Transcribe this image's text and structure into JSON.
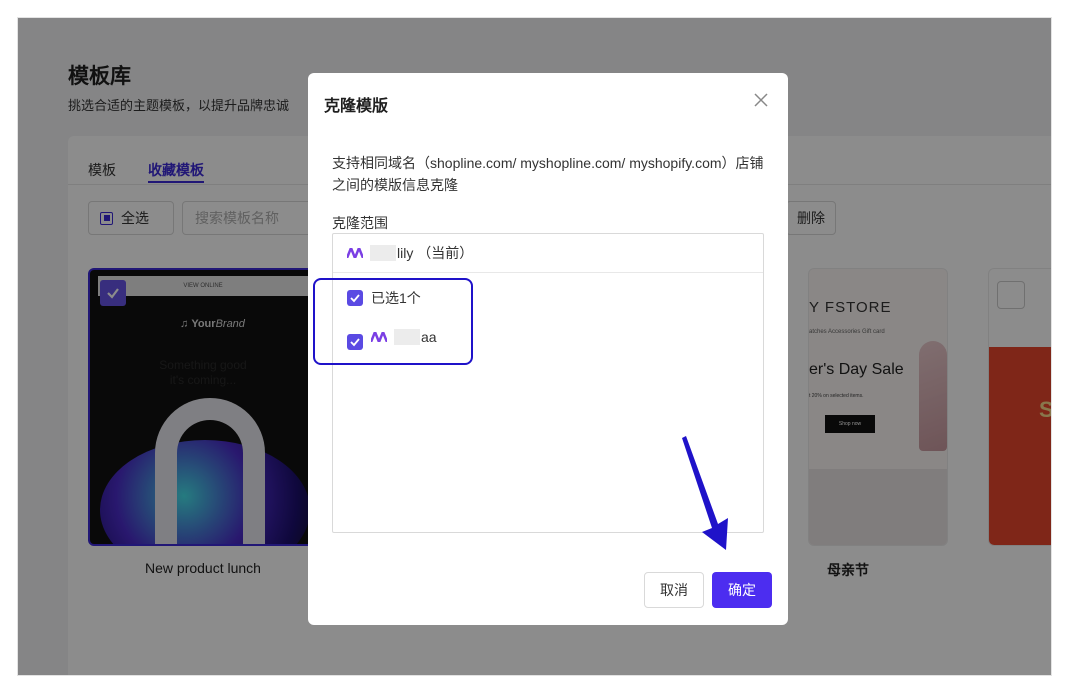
{
  "page": {
    "title": "模板库",
    "subtitle": "挑选合适的主题模板，以提升品牌忠诚"
  },
  "tabs": [
    {
      "label": "模板"
    },
    {
      "label": "收藏模板",
      "active": true
    }
  ],
  "toolbar": {
    "select_all_label": "全选",
    "search_placeholder": "搜索模板名称",
    "delete_label": "删除"
  },
  "cards": [
    {
      "name": "New product lunch",
      "selected": true,
      "preview": {
        "header": "VIEW ONLINE",
        "brand_a": "Your",
        "brand_b": "Brand",
        "teaser_1": "Something good",
        "teaser_2": "it's coming..."
      }
    },
    {
      "name": "母亲节",
      "selected": false,
      "preview": {
        "store": "Y FSTORE",
        "nav": "atches  Accessories  Gift card",
        "headline": "er's Day Sale",
        "offer": "t 20% on selected items.",
        "cta": "Shop now"
      }
    },
    {
      "name": "",
      "selected": false,
      "preview": {
        "letter": "S"
      }
    }
  ],
  "modal": {
    "title": "克隆模版",
    "description": "支持相同域名（shopline.com/ myshopline.com/ myshopify.com）店铺之间的模版信息克隆",
    "range_label": "克隆范围",
    "current_store": "lily （当前）",
    "selected_count": "已选1个",
    "stores": [
      {
        "name": "aa",
        "checked": true
      }
    ],
    "cancel_label": "取消",
    "confirm_label": "确定"
  },
  "colors": {
    "accent": "#3d2bd7",
    "primary_button": "#4c2df0",
    "highlight": "#1f12c9"
  },
  "icons": [
    "close-icon",
    "checkmark-icon",
    "music-note-icon",
    "store-logo-icon",
    "arrow-annotation"
  ]
}
